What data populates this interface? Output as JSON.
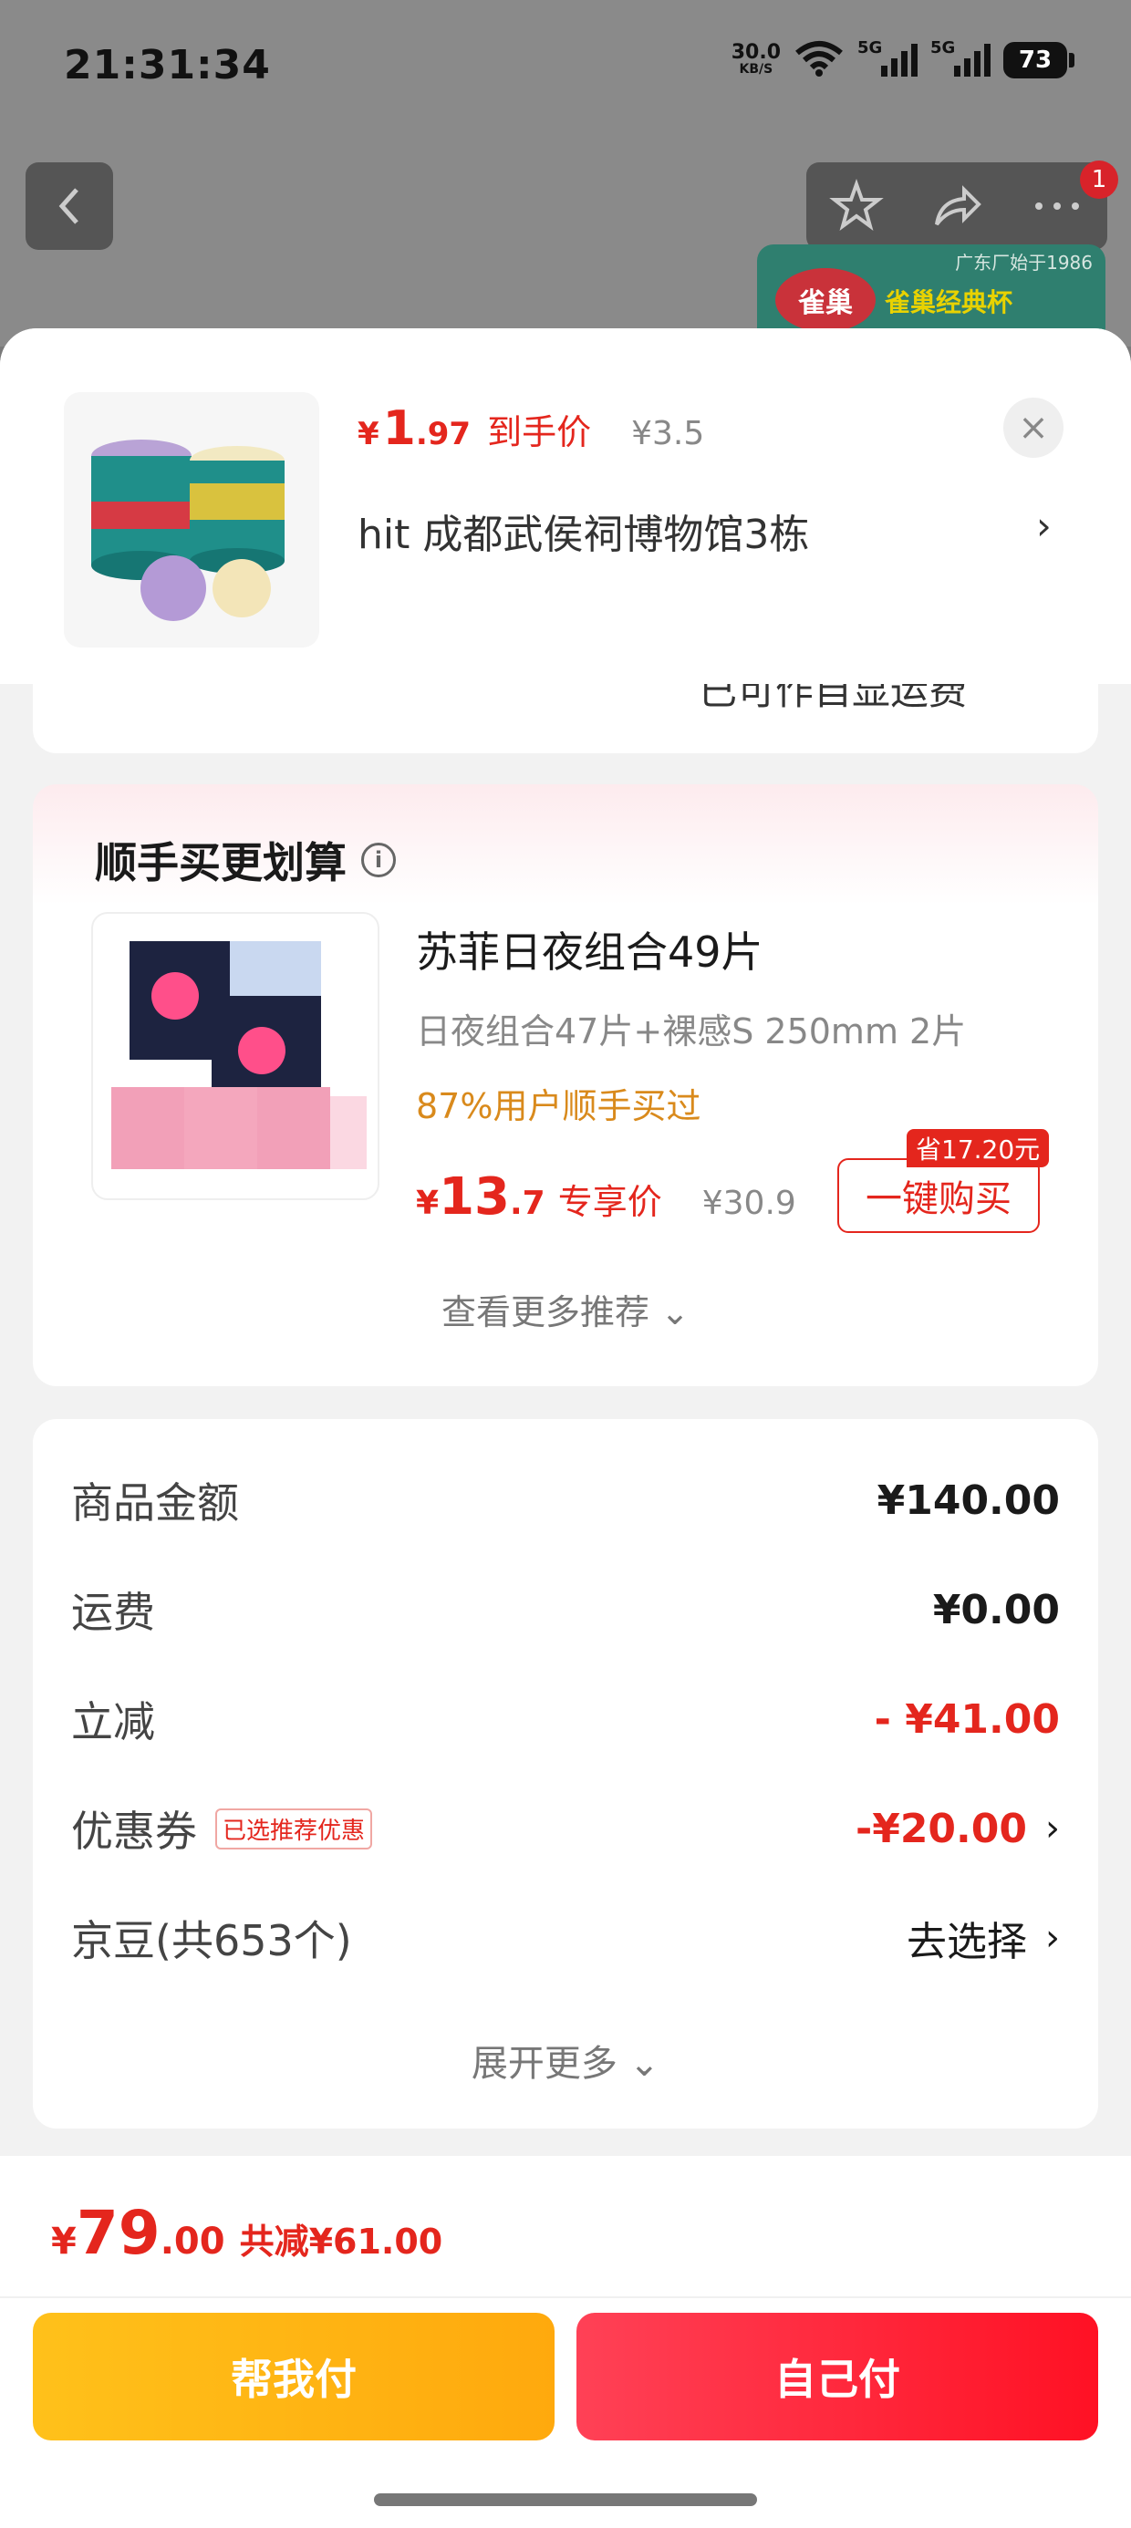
{
  "status_bar": {
    "time": "21:31:34",
    "net_speed": "30.0",
    "net_speed_unit": "KB/S",
    "signal_label_1": "5G",
    "signal_label_2": "5G",
    "battery": "73"
  },
  "background": {
    "notification_count": "1",
    "banner_brand": "雀巢",
    "banner_line": "雀巢经典杯",
    "banner_slogan": "广东厂始于1986"
  },
  "sheet_header": {
    "price_yen": "¥",
    "price_int": "1",
    "price_dec": ".97",
    "price_tag": "到手价",
    "original_price": "¥3.5",
    "address": "hit  成都武侯祠博物馆3栋",
    "address_chevron": "›",
    "close": "×"
  },
  "partial_card_text": "已可作自显运费",
  "recommendation": {
    "title": "顺手买更划算",
    "info_glyph": "i",
    "product_name": "苏菲日夜组合49片",
    "spec": "日夜组合47片+裸感S 250mm 2片",
    "bought_rate": "87%用户顺手买过",
    "price_yen": "¥",
    "price_int": "13",
    "price_dec": ".7",
    "price_tag": "专享价",
    "original_price": "¥30.9",
    "save_badge": "省17.20元",
    "buy_button": "一键购买",
    "see_more": "查看更多推荐 ⌄"
  },
  "summary": {
    "rows": [
      {
        "label": "商品金额",
        "value": "¥140.00"
      },
      {
        "label": "运费",
        "value": "¥0.00"
      },
      {
        "label": "立减",
        "value": "- ¥41.00"
      },
      {
        "label": "优惠券",
        "tag": "已选推荐优惠",
        "value": "-¥20.00",
        "chevron": "›"
      },
      {
        "label": "京豆(共653个)",
        "value": "去选择",
        "chevron": "›"
      }
    ],
    "expand_more": "展开更多 ⌄"
  },
  "bottom_bar": {
    "total_yen": "¥",
    "total_int": "79",
    "total_dec": ".00",
    "total_saving": "共减¥61.00",
    "help_pay_button": "帮我付",
    "self_pay_button": "自己付"
  },
  "colors": {
    "accent_red": "#e4261d",
    "help_pay_yellow": "#ffb412",
    "self_pay_red": "#ff2a3a",
    "bought_orange": "#d98a1c"
  }
}
